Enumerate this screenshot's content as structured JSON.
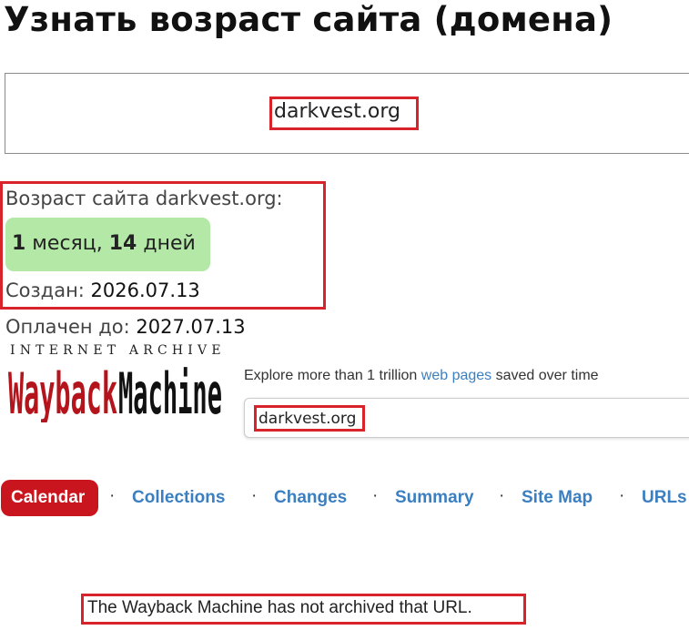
{
  "page_title": "Узнать возраст сайта (домена)",
  "domain_input": {
    "value": "darkvest.org"
  },
  "result": {
    "age_label": "Возраст сайта darkvest.org:",
    "age_months_num": "1",
    "age_months_unit": " месяц, ",
    "age_days_num": "14",
    "age_days_unit": " дней",
    "created_label": "Создан: ",
    "created_value": "2026.07.13",
    "paid_label": "Оплачен до: ",
    "paid_value": "2027.07.13"
  },
  "wayback": {
    "ia_text": "INTERNET ARCHIVE",
    "logo_text": "WaybackMachine",
    "explore_prefix": "Explore more than 1 trillion ",
    "explore_link": "web pages",
    "explore_suffix": " saved over time",
    "search_value": "darkvest.org",
    "tabs": [
      "Calendar",
      "Collections",
      "Changes",
      "Summary",
      "Site Map",
      "URLs"
    ],
    "separator": "·",
    "message": "The Wayback Machine has not archived that URL."
  },
  "colors": {
    "highlight_box": "#d9232b",
    "age_badge": "#b3e8a7",
    "wayback_red": "#c9151e",
    "link_blue": "#3c7fc0"
  }
}
